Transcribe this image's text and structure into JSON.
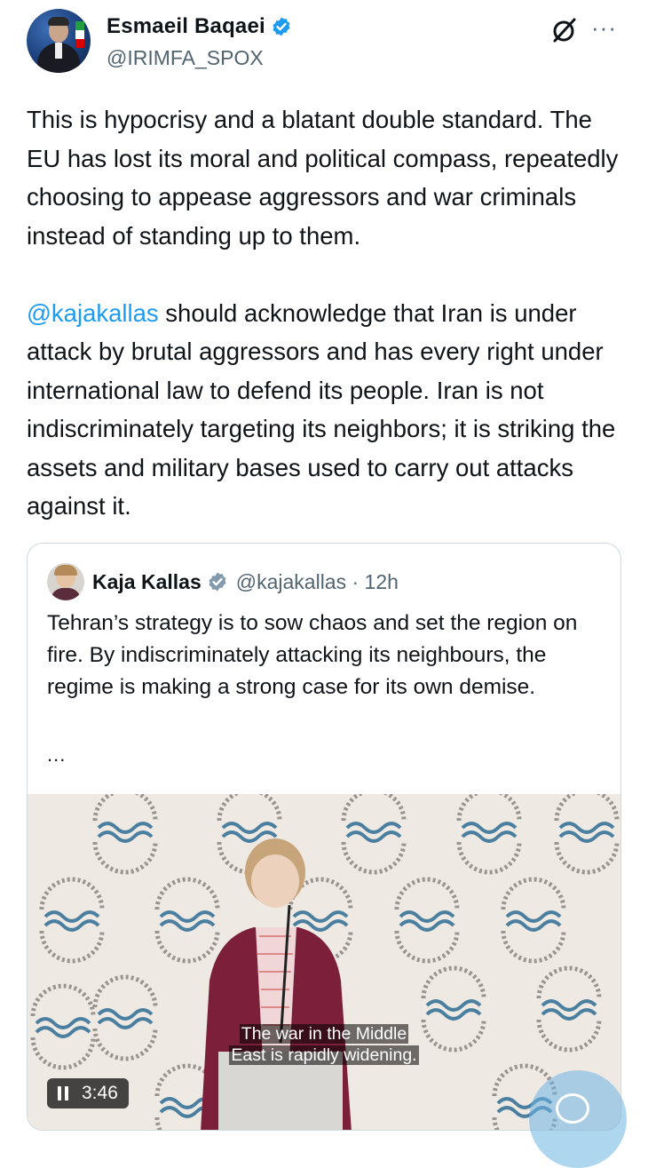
{
  "author": {
    "name": "Esmaeil Baqaei",
    "handle": "@IRIMFA_SPOX",
    "verified": true
  },
  "header_icons": {
    "grok": "grok-icon",
    "more": "···"
  },
  "tweet": {
    "paragraph1": "This is hypocrisy and a blatant double standard. The EU has lost its moral and political compass, repeatedly choosing to appease aggressors and war criminals instead of standing up to them.",
    "mention": "@kajakallas",
    "paragraph2_rest": " should acknowledge that Iran is under attack by brutal aggressors and has every right under international law to defend its people. Iran is not indiscriminately targeting its neighbors; it is striking the assets and military bases used to carry out attacks against it."
  },
  "quoted": {
    "name": "Kaja Kallas",
    "handle_time": "@kajakallas · 12h",
    "verified": true,
    "text": "Tehran’s strategy is to sow chaos and set the region on fire. By indiscriminately attacking its neighbours, the regime is making a strong case for its own demise.",
    "ellipsis": "...",
    "video": {
      "subtitle_line1": "The war in the Middle",
      "subtitle_line2": "East is rapidly widening.",
      "duration": "3:46"
    }
  },
  "colors": {
    "link": "#1d9bf0",
    "verified": "#1d9bf0",
    "muted": "#536471"
  }
}
